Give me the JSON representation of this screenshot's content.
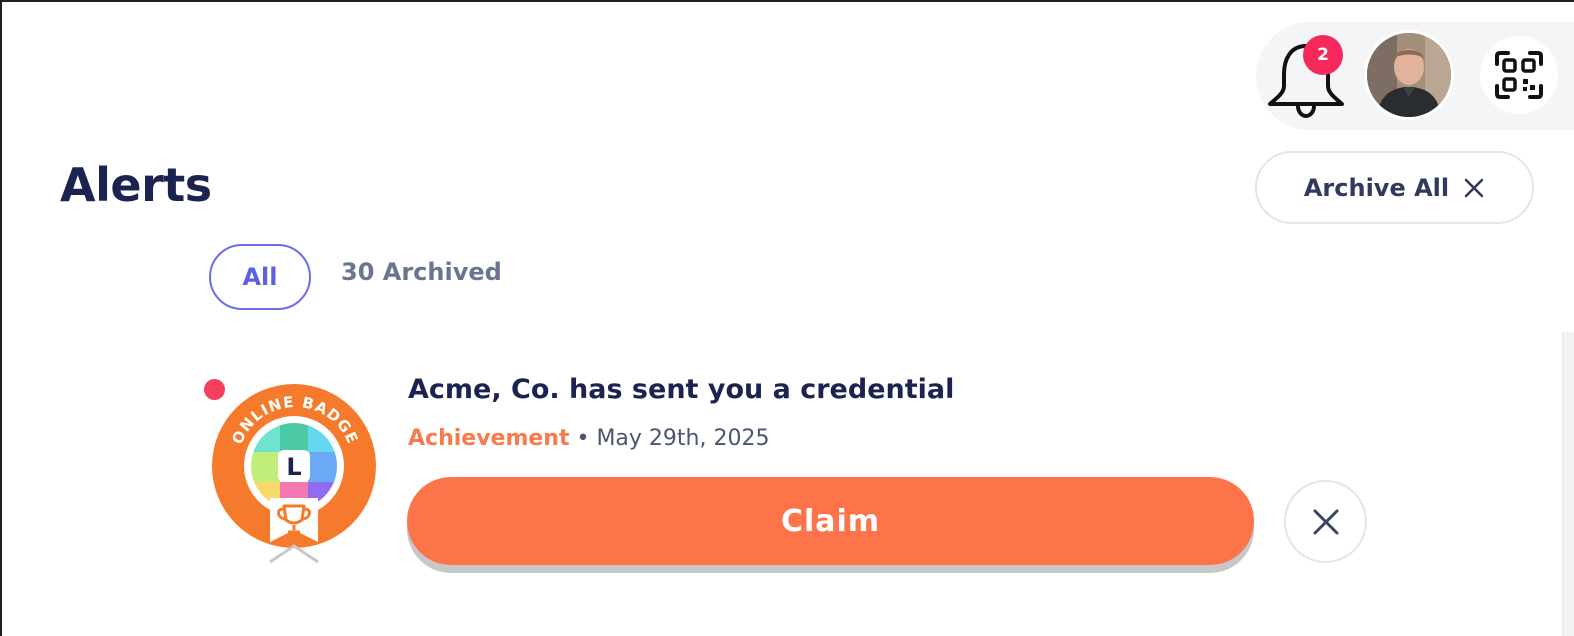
{
  "header": {
    "notifications_count": "2",
    "icons": {
      "bell": "bell-icon",
      "qr": "qr-code-icon",
      "avatar": "user-avatar"
    }
  },
  "page": {
    "title": "Alerts",
    "archive_all_label": "Archive All"
  },
  "tabs": {
    "all_label": "All",
    "archived_label": "30 Archived"
  },
  "alerts": [
    {
      "title": "Acme, Co. has sent you a credential",
      "category": "Achievement",
      "separator": " • ",
      "date": "May 29th, 2025",
      "action_label": "Claim",
      "badge_text": "ONLINE BADGE",
      "badge_letter": "L",
      "unread": true
    }
  ],
  "colors": {
    "primary_text": "#1b2450",
    "accent_purple": "#5d60e6",
    "claim_orange": "#fd744b",
    "category_orange": "#f97a4b",
    "unread_red": "#f2405e",
    "notification_red": "#f5285c"
  }
}
